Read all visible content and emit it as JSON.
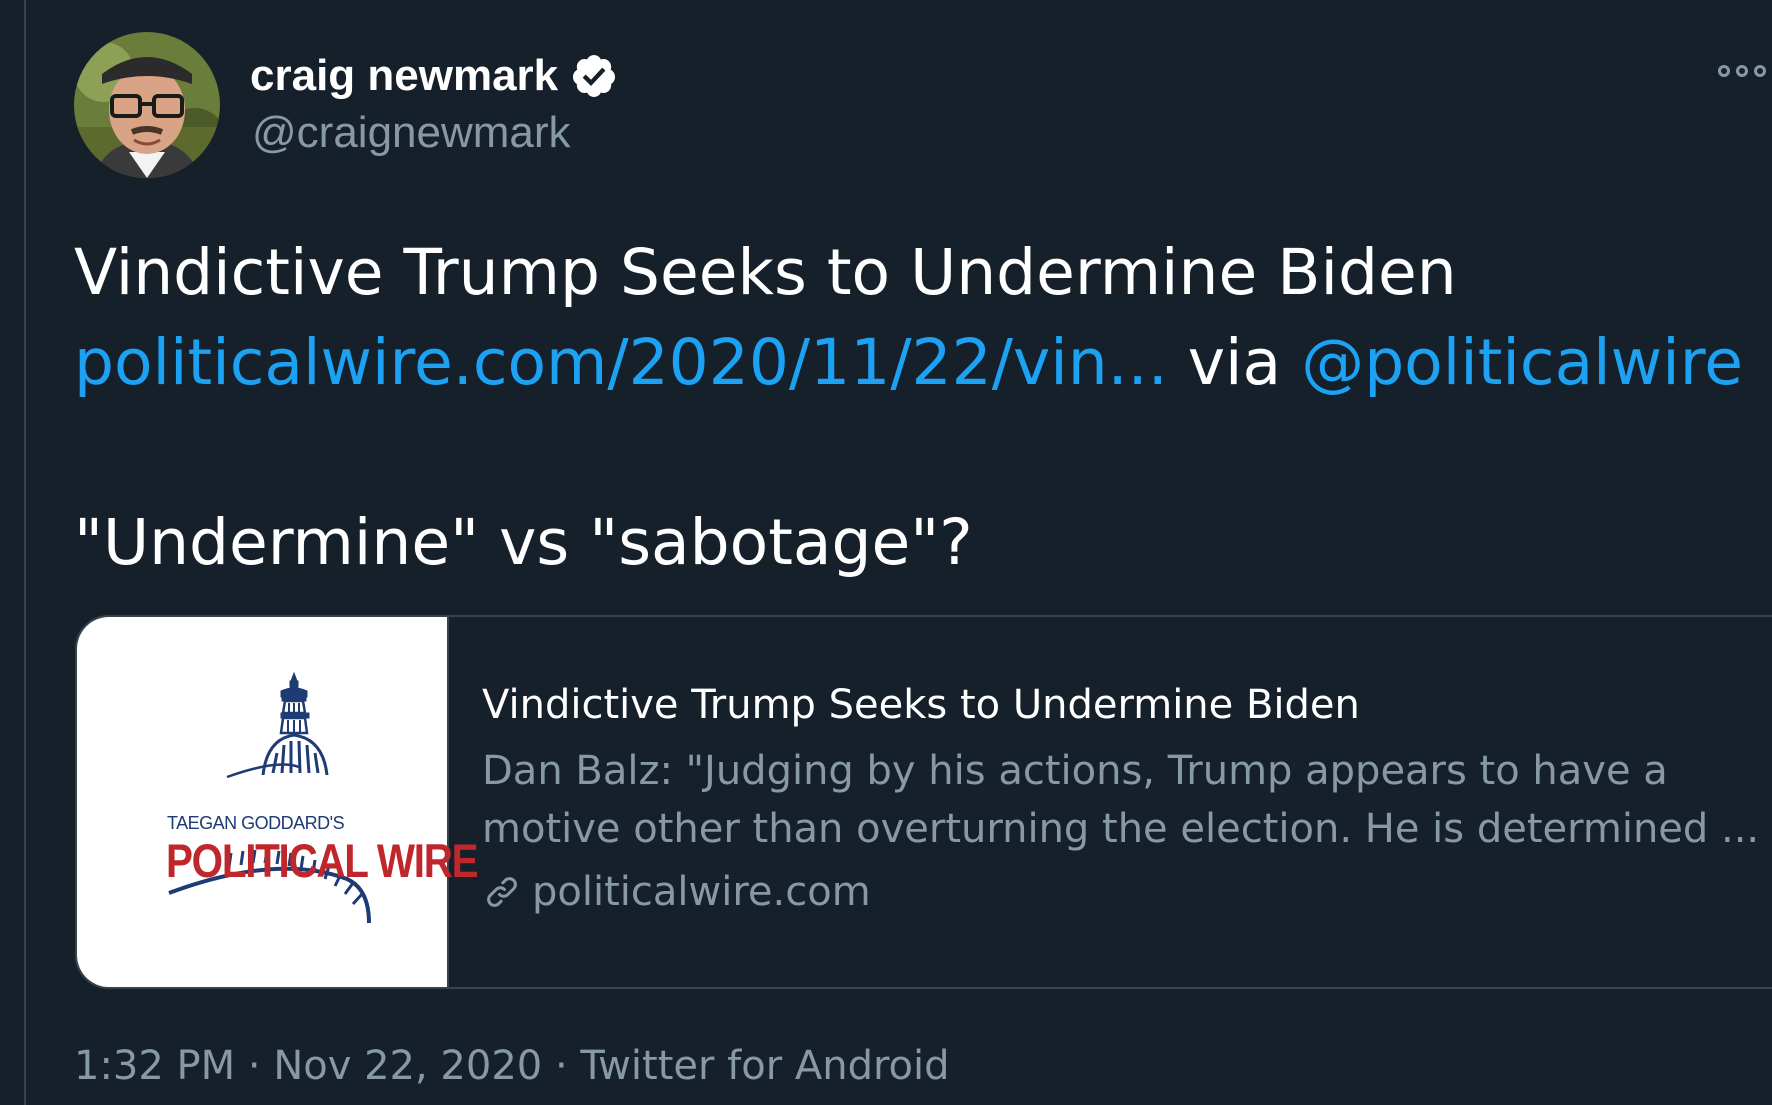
{
  "author": {
    "display_name": "craig newmark",
    "handle": "@craignewmark",
    "verified": true,
    "avatar_icon": "profile-photo"
  },
  "tweet": {
    "line1": "Vindictive Trump Seeks to Undermine Biden",
    "link_text": "politicalwire.com/2020/11/22/vin...",
    "via_text": " via ",
    "mention": "@politicalwire",
    "line3": "\"Undermine\" vs \"sabotage\"?"
  },
  "card": {
    "logo_top_text": "TAEGAN GODDARD'S",
    "logo_main_text": "POLITICAL WIRE",
    "title": "Vindictive Trump Seeks to Undermine Biden",
    "description_line1": "Dan Balz: \"Judging by his actions, Trump appears to have a",
    "description_line2": "motive other than overturning the election. He is determined ...",
    "domain": "politicalwire.com"
  },
  "meta": {
    "timestamp_line": "1:32 PM · Nov 22, 2020 · Twitter for Android"
  },
  "colors": {
    "background": "#15202b",
    "link": "#1da1f2",
    "secondary_text": "#8899a6",
    "border": "#38444d",
    "logo_red": "#c0272d",
    "logo_blue": "#1f3b73"
  }
}
